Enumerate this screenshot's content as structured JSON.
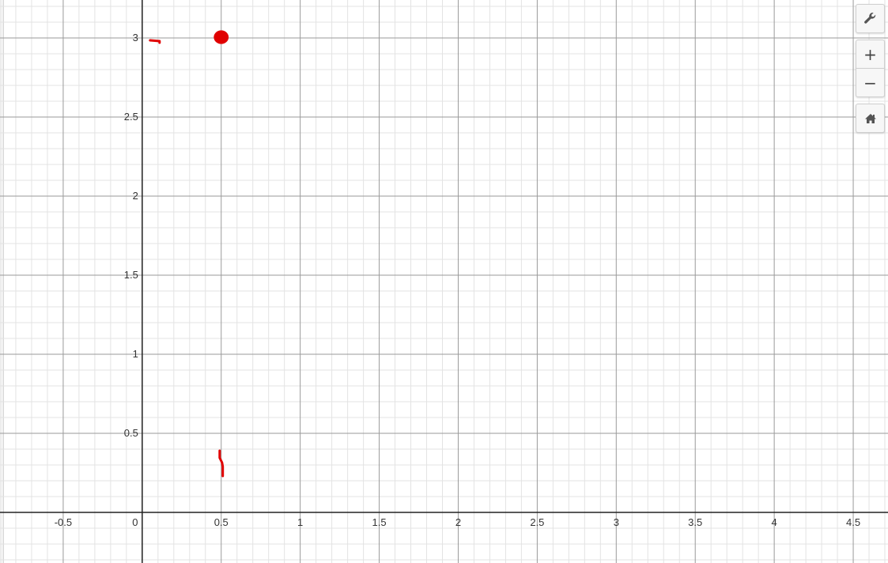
{
  "graph": {
    "x_tick_labels": [
      "-0.5",
      "0",
      "0.5",
      "1",
      "1.5",
      "2",
      "2.5",
      "3",
      "3.5",
      "4",
      "4.5"
    ],
    "x_tick_values": [
      -0.5,
      0,
      0.5,
      1,
      1.5,
      2,
      2.5,
      3,
      3.5,
      4,
      4.5
    ],
    "y_tick_labels": [
      "0.5",
      "1",
      "1.5",
      "2",
      "2.5",
      "3"
    ],
    "y_tick_values": [
      0.5,
      1,
      1.5,
      2,
      2.5,
      3
    ],
    "x_range": [
      -0.9,
      4.72
    ],
    "y_range": [
      -0.32,
      3.24
    ],
    "ink_color": "#e00000",
    "strokes": [
      {
        "name": "ink-dash-near-y3",
        "width": 3,
        "points": [
          [
            0.05,
            2.985
          ],
          [
            0.11,
            2.98
          ],
          [
            0.11,
            2.97
          ]
        ]
      },
      {
        "name": "ink-vertical-stroke",
        "width": 3,
        "points": [
          [
            0.49,
            0.39
          ],
          [
            0.49,
            0.345
          ],
          [
            0.505,
            0.315
          ],
          [
            0.51,
            0.29
          ],
          [
            0.51,
            0.23
          ]
        ]
      }
    ],
    "blobs": [
      {
        "name": "ink-blob-at-0.5-3",
        "cx": 0.5,
        "cy": 3.005,
        "rx": 0.042,
        "ry": 0.038
      }
    ]
  },
  "controls": {
    "settings_icon": "wrench-icon",
    "zoom_in_label": "+",
    "zoom_out_label": "−",
    "home_icon": "home-icon"
  }
}
